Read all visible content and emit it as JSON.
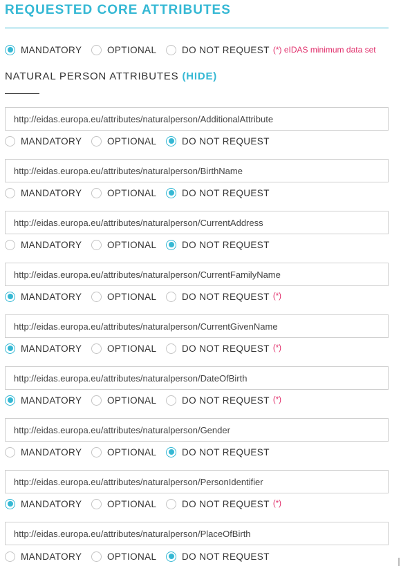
{
  "header": {
    "title": "REQUESTED CORE ATTRIBUTES"
  },
  "labels": {
    "mandatory": "MANDATORY",
    "optional": "OPTIONAL",
    "do_not_request": "DO NOT REQUEST",
    "asterisk": "(*)"
  },
  "global_selection": {
    "selected": "mandatory",
    "legend": "(*) eIDAS minimum data set"
  },
  "section": {
    "title": "NATURAL PERSON ATTRIBUTES",
    "toggle": "(HIDE)"
  },
  "colors": {
    "accent": "#35b8d4",
    "required_marker": "#e1306c"
  },
  "attributes": [
    {
      "uri": "http://eidas.europa.eu/attributes/naturalperson/AdditionalAttribute",
      "selected": "do_not_request",
      "minimum": false
    },
    {
      "uri": "http://eidas.europa.eu/attributes/naturalperson/BirthName",
      "selected": "do_not_request",
      "minimum": false
    },
    {
      "uri": "http://eidas.europa.eu/attributes/naturalperson/CurrentAddress",
      "selected": "do_not_request",
      "minimum": false
    },
    {
      "uri": "http://eidas.europa.eu/attributes/naturalperson/CurrentFamilyName",
      "selected": "mandatory",
      "minimum": true
    },
    {
      "uri": "http://eidas.europa.eu/attributes/naturalperson/CurrentGivenName",
      "selected": "mandatory",
      "minimum": true
    },
    {
      "uri": "http://eidas.europa.eu/attributes/naturalperson/DateOfBirth",
      "selected": "mandatory",
      "minimum": true
    },
    {
      "uri": "http://eidas.europa.eu/attributes/naturalperson/Gender",
      "selected": "do_not_request",
      "minimum": false
    },
    {
      "uri": "http://eidas.europa.eu/attributes/naturalperson/PersonIdentifier",
      "selected": "mandatory",
      "minimum": true
    },
    {
      "uri": "http://eidas.europa.eu/attributes/naturalperson/PlaceOfBirth",
      "selected": "do_not_request",
      "minimum": false
    }
  ]
}
